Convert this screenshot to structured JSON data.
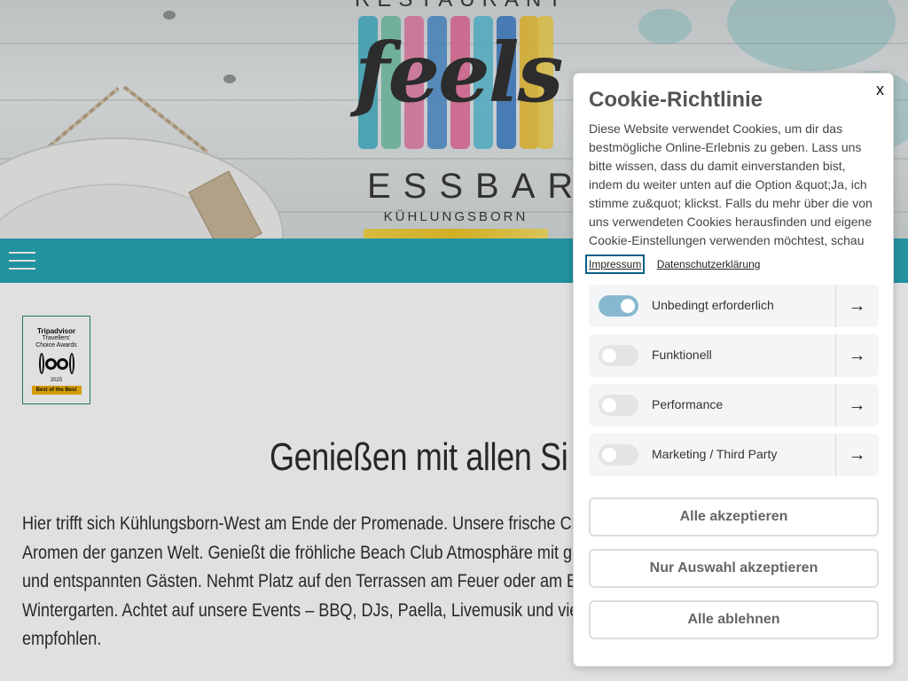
{
  "header": {
    "logo_top": "RESTAURANT",
    "logo_script": "feels",
    "logo_main": "ESSBAR",
    "logo_town": "KÜHLUNGSBORN"
  },
  "nav": {
    "menu_icon": "hamburger-icon"
  },
  "badge": {
    "brand": "Tripadvisor",
    "line1": "Travellers'",
    "line2": "Choice Awards",
    "year": "2025",
    "best": "Best of the Best"
  },
  "main": {
    "heading": "Genießen mit allen Si",
    "paragraph_lines": [
      "Hier trifft sich Kühlungsborn-West am Ende der Promenade. Unsere frische Cro",
      "Aromen der ganzen Welt. Genießt die fröhliche Beach Club Atmosphäre mit gu",
      "und entspannten Gästen. Nehmt Platz auf den Terrassen am Feuer oder am BBQ",
      "Wintergarten. Achtet auf unsere Events – BBQ, DJs, Paella, Livemusik und viele",
      "empfohlen."
    ]
  },
  "cookie": {
    "close_label": "x",
    "title": "Cookie-Richtlinie",
    "text": "Diese Website verwendet Cookies, um dir das bestmögliche Online-Erlebnis zu geben. Lass uns bitte wissen, dass du damit einverstanden bist, indem du weiter unten auf die Option &quot;Ja, ich stimme zu&quot; klickst. Falls du mehr über die von uns verwendeten Cookies herausfinden und eigene Cookie-Einstellungen verwenden möchtest, schau",
    "links": [
      "Impressum",
      "Datenschutzerklärung"
    ],
    "categories": [
      {
        "label": "Unbedingt erforderlich",
        "enabled": true
      },
      {
        "label": "Funktionell",
        "enabled": false
      },
      {
        "label": "Performance",
        "enabled": false
      },
      {
        "label": "Marketing / Third Party",
        "enabled": false
      }
    ],
    "arrow_icon": "arrow-right-icon",
    "buttons": {
      "accept_all": "Alle akzeptieren",
      "accept_selection": "Nur Auswahl akzeptieren",
      "reject_all": "Alle ablehnen"
    }
  },
  "colors": {
    "nav_bar": "#27a7b8",
    "toggle_on": "#86b9cf",
    "focus_outline": "#0a5f86"
  }
}
